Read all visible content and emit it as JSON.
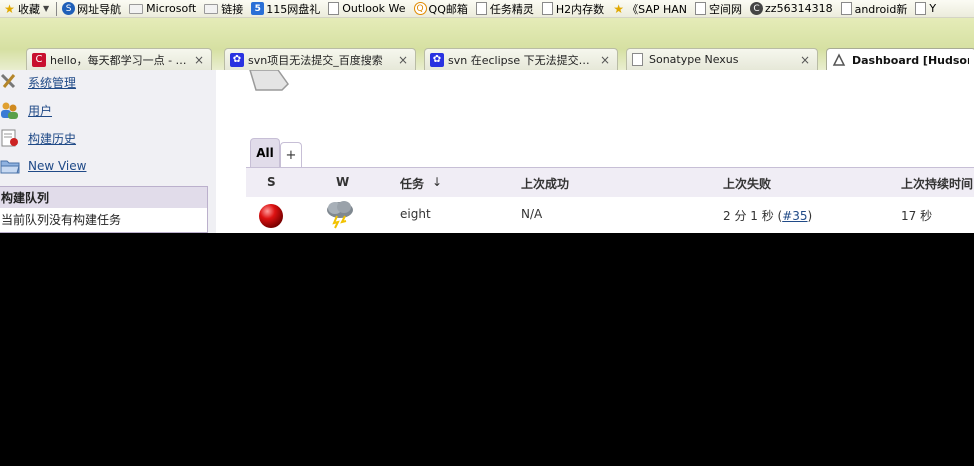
{
  "bookmarks": [
    {
      "label": "收藏",
      "icon": "star-icon"
    },
    {
      "label": "网址导航",
      "icon": "sogou-icon"
    },
    {
      "label": "Microsoft",
      "icon": "folder-icon"
    },
    {
      "label": "链接",
      "icon": "folder-icon"
    },
    {
      "label": "115网盘礼",
      "icon": "115-icon"
    },
    {
      "label": "Outlook We",
      "icon": "page-icon"
    },
    {
      "label": "QQ邮箱",
      "icon": "qq-icon"
    },
    {
      "label": "任务精灵",
      "icon": "page-icon"
    },
    {
      "label": "H2内存数",
      "icon": "page-icon"
    },
    {
      "label": "《SAP HAN",
      "icon": "star-icon"
    },
    {
      "label": "空间网",
      "icon": "page-icon"
    },
    {
      "label": "zz56314318",
      "icon": "csdn-icon"
    },
    {
      "label": "android新",
      "icon": "page-icon"
    },
    {
      "label": "Y",
      "icon": "page-icon"
    }
  ],
  "tabs": [
    {
      "title": "hello，每天都学习一点 - …",
      "icon": "csdn-icon",
      "active": false
    },
    {
      "title": "svn项目无法提交_百度搜索",
      "icon": "baidu-icon",
      "active": false
    },
    {
      "title": "svn 在eclipse 下无法提交…",
      "icon": "baidu-icon",
      "active": false
    },
    {
      "title": "Sonatype Nexus",
      "icon": "page-icon",
      "active": false
    },
    {
      "title": "Dashboard [Hudson]",
      "icon": "hudson-icon",
      "active": true
    }
  ],
  "sidebar": {
    "items": [
      {
        "label": "系统管理",
        "icon": "tools-icon"
      },
      {
        "label": "用户",
        "icon": "users-icon"
      },
      {
        "label": "构建历史",
        "icon": "build-history-icon"
      },
      {
        "label": "New View",
        "icon": "folder-view-icon"
      }
    ],
    "queue": {
      "title": "构建队列",
      "empty_text": "当前队列没有构建任务"
    }
  },
  "views": {
    "all_label": "All",
    "add_label": "+"
  },
  "jobs_table": {
    "headers": {
      "status": "S",
      "weather": "W",
      "job": "任务",
      "sort_arrow": "↓",
      "last_success": "上次成功",
      "last_failure": "上次失败",
      "last_duration": "上次持续时间"
    },
    "rows": [
      {
        "status_color": "#cc0000",
        "weather_icon": "storm-icon",
        "job": "eight",
        "last_success": "N/A",
        "last_failure": "2 分 1 秒 (",
        "last_failure_build": "#35",
        "last_failure_suffix": ")",
        "last_duration": "17 秒"
      }
    ]
  },
  "colors": {
    "failed_ball": "#cc0000",
    "header_bg": "#f0edf5",
    "tab_bar_bg": "#d6e0a2"
  }
}
